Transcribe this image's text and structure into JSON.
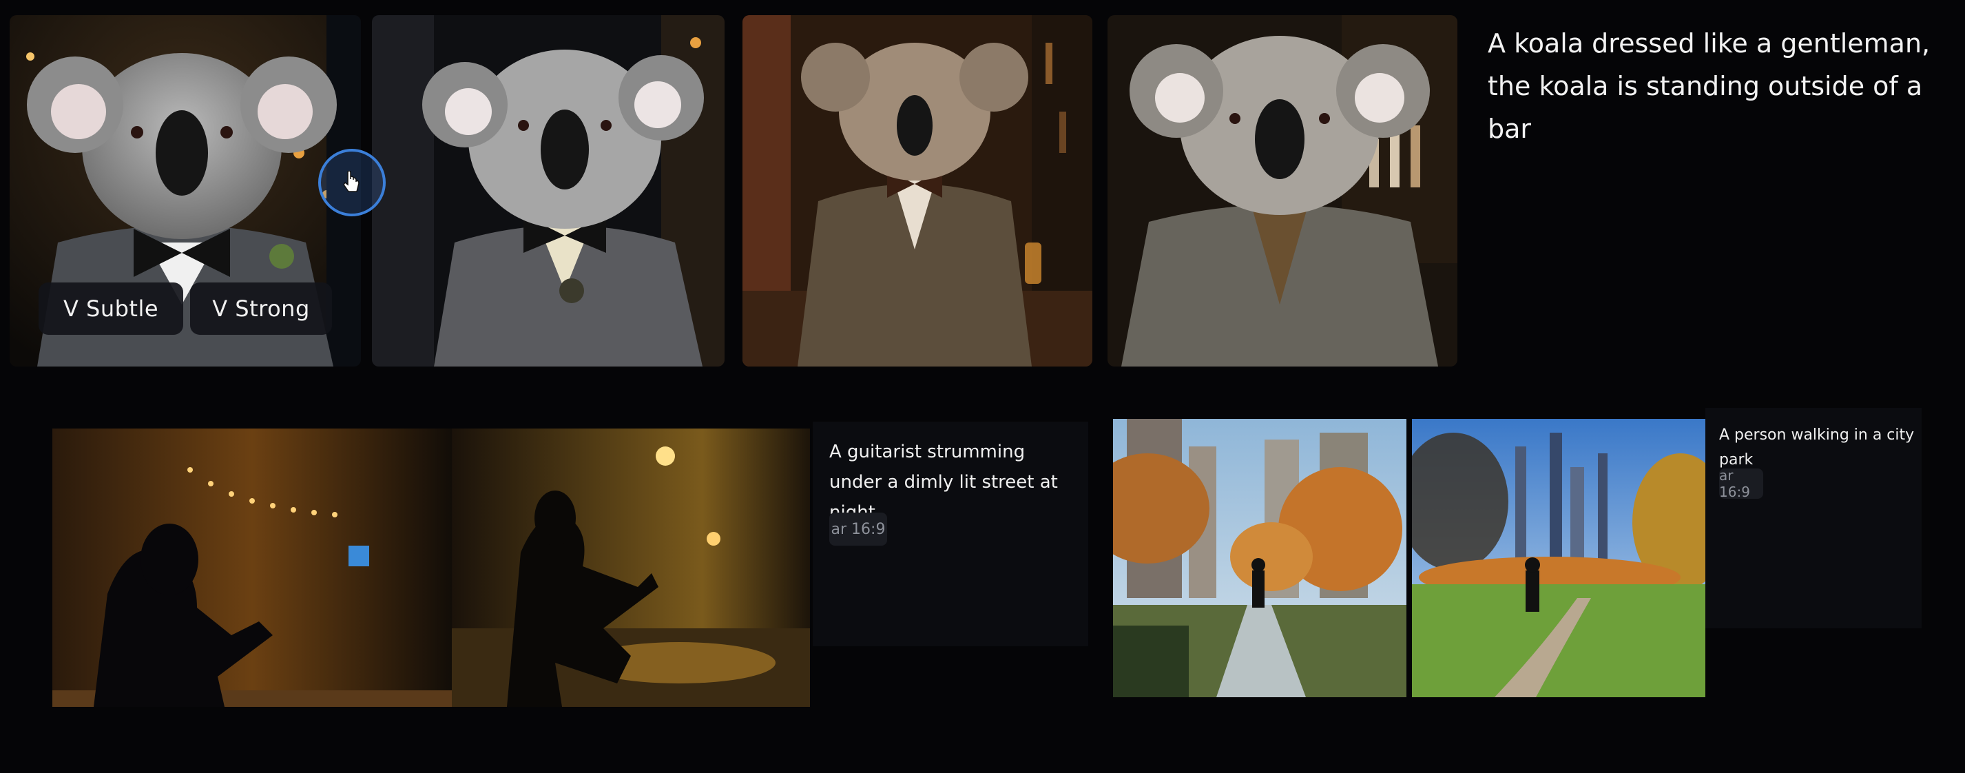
{
  "koala_section": {
    "prompt": "A koala dressed like a gentleman, the koala is standing outside of a bar",
    "buttons": {
      "subtle": "V Subtle",
      "strong": "V Strong"
    }
  },
  "guitarist_section": {
    "prompt": "A guitarist strumming under a dimly lit street at night",
    "tag": "ar 16:9"
  },
  "park_section": {
    "prompt": "A person walking in a city park",
    "tag": "ar 16:9"
  },
  "icons": [
    "pointer-cursor-icon"
  ],
  "colors": {
    "background": "#050507",
    "cursor_ring": "#3b7fd9",
    "tag_bg": "#1a1c22"
  }
}
